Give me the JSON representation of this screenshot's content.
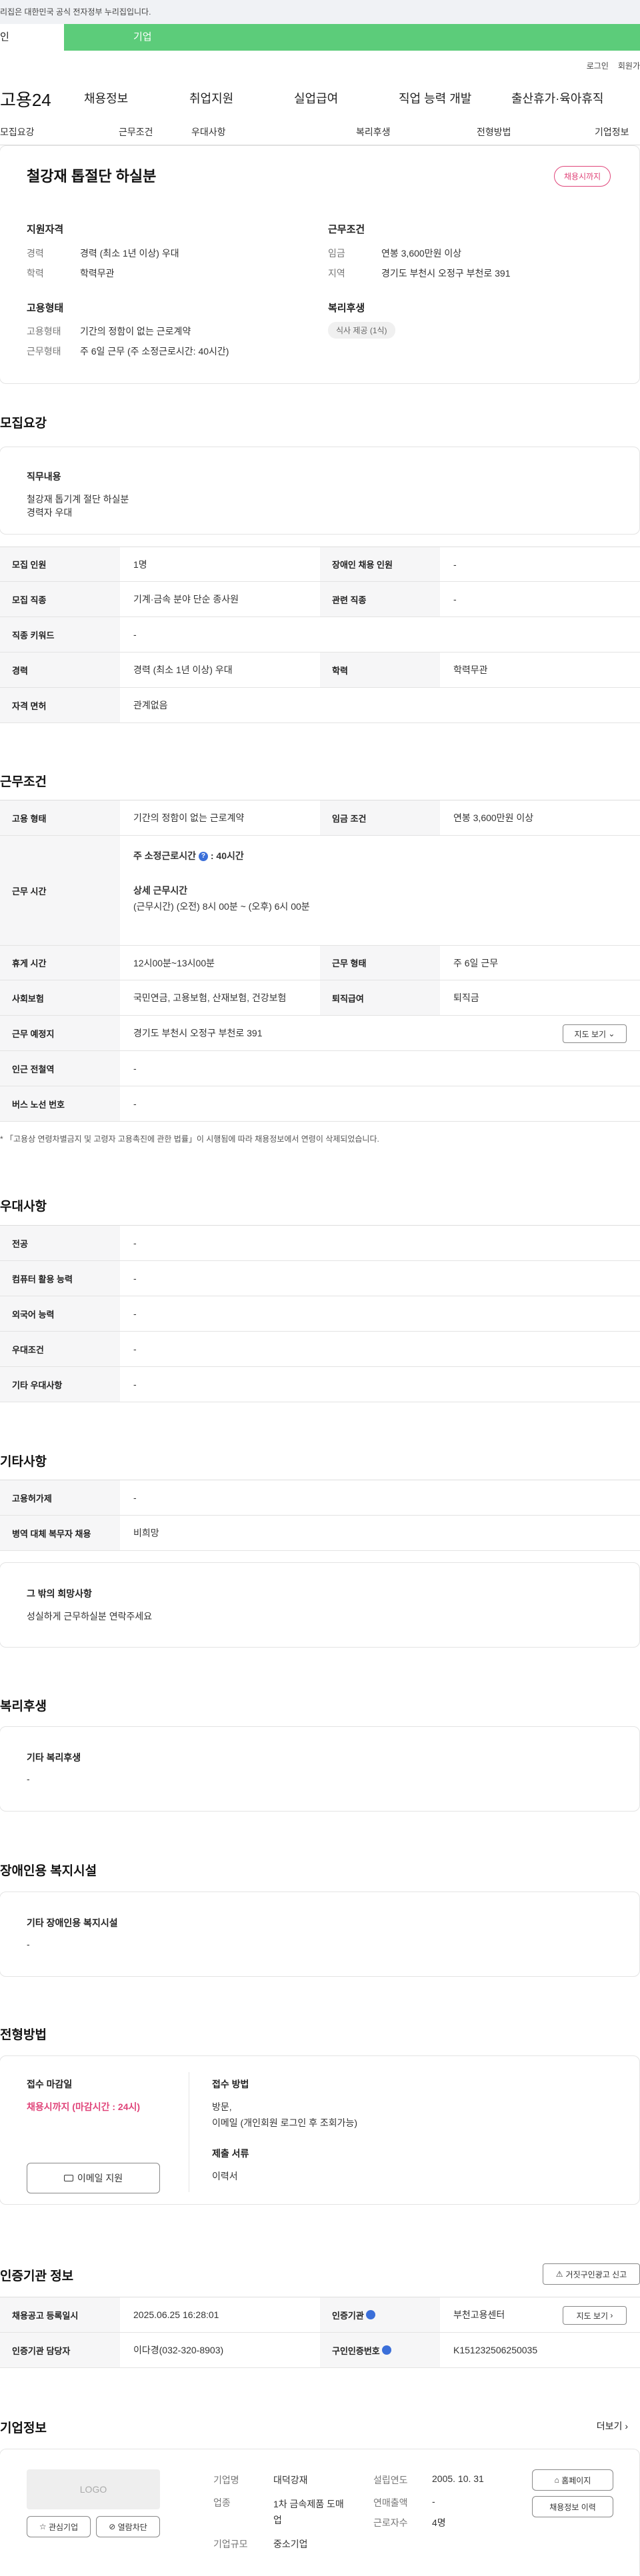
{
  "gov_banner": "리집은 대한민국 공식 전자정부 누리집입니다.",
  "user_tabs": {
    "personal": "인",
    "company": "기업"
  },
  "top_links": {
    "login": "로그인",
    "join": "회원가"
  },
  "gnb": {
    "logo": "고용24",
    "menu": [
      "채용정보",
      "취업지원",
      "실업급여",
      "직업 능력 개발",
      "출산휴가·육아휴직"
    ]
  },
  "sub_tabs": [
    "모집요강",
    "근무조건",
    "우대사항",
    "복리후생",
    "전형방법",
    "기업정보"
  ],
  "job": {
    "title": "철강재 톱절단 하실분",
    "status_badge": "채용시까지",
    "qual": {
      "heading": "지원자격",
      "career_label": "경력",
      "career": "경력 (최소 1년 이상) 우대",
      "edu_label": "학력",
      "edu": "학력무관"
    },
    "cond": {
      "heading": "근무조건",
      "pay_label": "임금",
      "pay": "연봉 3,600만원 이상",
      "area_label": "지역",
      "area": "경기도 부천시 오정구 부천로 391"
    },
    "emp": {
      "heading": "고용형태",
      "type_label": "고용형태",
      "type": "기간의 정함이 없는 근로계약",
      "form_label": "근무형태",
      "form": "주 6일 근무 (주 소정근로시간: 40시간)"
    },
    "welfare": {
      "heading": "복리후생",
      "chip": "식사 제공 (1식)"
    }
  },
  "recruit": {
    "title": "모집요강",
    "duty_heading": "직무내용",
    "duty_line1": "철강재 톱기계 절단 하실분",
    "duty_line2": "경력자 우대",
    "rows": [
      {
        "l1": "모집 인원",
        "v1": "1명",
        "l2": "장애인 채용 인원",
        "v2": "-"
      },
      {
        "l1": "모집 직종",
        "v1": "기계·금속 분야 단순 종사원",
        "l2": "관련 직종",
        "v2": "-"
      },
      {
        "l1": "직종 키워드",
        "v1": "-"
      },
      {
        "l1": "경력",
        "v1": "경력 (최소 1년 이상) 우대",
        "l2": "학력",
        "v2": "학력무관"
      },
      {
        "l1": "자격 면허",
        "v1": "관계없음"
      }
    ]
  },
  "work": {
    "title": "근무조건",
    "type_label": "고용 형태",
    "type": "기간의 정함이 없는 근로계약",
    "pay_label": "임금 조건",
    "pay": "연봉 3,600만원 이상",
    "hours_label": "근무 시간",
    "hours_weekly": "주 소정근로시간",
    "hours_weekly_val": "40시간",
    "hours_detail_heading": "상세 근무시간",
    "hours_detail": "(근무시간) (오전) 8시 00분 ~ (오후) 6시 00분",
    "break_label": "휴게 시간",
    "break": "12시00분~13시00분",
    "form_label": "근무 형태",
    "form": "주 6일 근무",
    "ins_label": "사회보험",
    "ins": "국민연금, 고용보험, 산재보험, 건강보험",
    "sev_label": "퇴직급여",
    "sev": "퇴직금",
    "place_label": "근무 예정지",
    "place": "경기도 부천시 오정구 부천로 391",
    "map_btn": "지도 보기",
    "station_label": "인근 전철역",
    "station": "-",
    "bus_label": "버스 노선 번호",
    "bus": "-",
    "note": "* 「고용상 연령차별금지 및 고령자 고용촉진에 관한 법률」이 시행됨에 따라 채용정보에서 연령이 삭제되었습니다."
  },
  "pref": {
    "title": "우대사항",
    "rows": [
      {
        "l": "전공",
        "v": "-"
      },
      {
        "l": "컴퓨터 활용 능력",
        "v": "-"
      },
      {
        "l": "외국어 능력",
        "v": "-"
      },
      {
        "l": "우대조건",
        "v": "-"
      },
      {
        "l": "기타 우대사항",
        "v": "-"
      }
    ]
  },
  "etc": {
    "title": "기타사항",
    "rows": [
      {
        "l": "고용허가제",
        "v": "-"
      },
      {
        "l": "병역 대체 복무자 채용",
        "v": "비희망"
      }
    ],
    "box_heading": "그 밖의 희망사항",
    "box_text": "성실하게 근무하실분 연락주세요"
  },
  "benefit": {
    "title": "복리후생",
    "box_heading": "기타 복리후생",
    "box_text": "-"
  },
  "disabled": {
    "title": "장애인용 복지시설",
    "box_heading": "기타 장애인용 복지시설",
    "box_text": "-"
  },
  "select": {
    "title": "전형방법",
    "deadline_heading": "접수 마감일",
    "deadline": "채용시까지 (마감시간 : 24시)",
    "email_btn": "이메일 지원",
    "method_heading": "접수 방법",
    "method_line1": "방문,",
    "method_line2": "이메일 (개인회원 로그인 후 조회가능)",
    "docs_heading": "제출 서류",
    "docs": "이력서"
  },
  "agency": {
    "title": "인증기관 정보",
    "report_btn": "거짓구인광고 신고",
    "reg_label": "채용공고 등록일시",
    "reg": "2025.06.25 16:28:01",
    "org_label": "인증기관",
    "org": "부천고용센터",
    "map_btn": "지도 보기",
    "mgr_label": "인증기관 담당자",
    "mgr": "이다경(032-320-8903)",
    "no_label": "구인인증번호",
    "no": "K151232506250035"
  },
  "company": {
    "title": "기업정보",
    "more": "더보기",
    "logo": "LOGO",
    "fav_btn": "관심기업",
    "block_btn": "열람차단",
    "name_label": "기업명",
    "name": "대덕강재",
    "biz_label": "업종",
    "biz": "1차 금속제품 도매업",
    "size_label": "기업규모",
    "size": "중소기업",
    "year_label": "설립연도",
    "year": "2005. 10. 31",
    "sales_label": "연매출액",
    "sales": "-",
    "emp_label": "근로자수",
    "emp": "4명",
    "home_btn": "홈페이지",
    "jobs_btn": "채용정보 이력"
  }
}
